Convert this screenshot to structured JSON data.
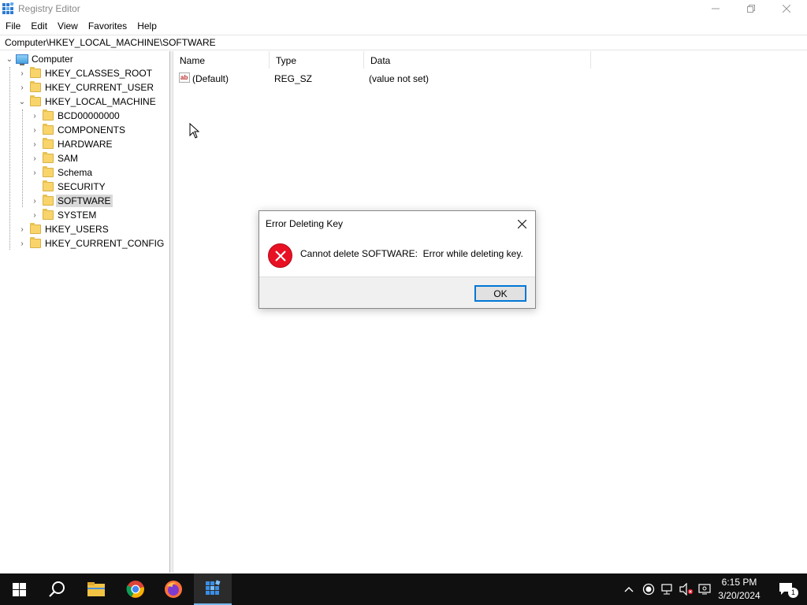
{
  "window": {
    "title": "Registry Editor"
  },
  "menu": [
    "File",
    "Edit",
    "View",
    "Favorites",
    "Help"
  ],
  "address": "Computer\\HKEY_LOCAL_MACHINE\\SOFTWARE",
  "tree": {
    "root": "Computer",
    "hives": [
      "HKEY_CLASSES_ROOT",
      "HKEY_CURRENT_USER",
      "HKEY_LOCAL_MACHINE",
      "HKEY_USERS",
      "HKEY_CURRENT_CONFIG"
    ],
    "hklm_children": [
      "BCD00000000",
      "COMPONENTS",
      "HARDWARE",
      "SAM",
      "Schema",
      "SECURITY",
      "SOFTWARE",
      "SYSTEM"
    ],
    "selected": "SOFTWARE"
  },
  "list": {
    "columns": [
      "Name",
      "Type",
      "Data"
    ],
    "rows": [
      {
        "name": "(Default)",
        "type": "REG_SZ",
        "data": "(value not set)"
      }
    ]
  },
  "dialog": {
    "title": "Error Deleting Key",
    "message": "Cannot delete SOFTWARE:  Error while deleting key.",
    "ok_label": "OK"
  },
  "taskbar": {
    "time": "6:15 PM",
    "date": "3/20/2024",
    "notification_count": "1",
    "icons": [
      "windows-start-icon",
      "search-icon",
      "file-explorer-icon",
      "chrome-icon",
      "firefox-icon",
      "registry-editor-icon"
    ]
  },
  "colors": {
    "error": "#e81123",
    "accent": "#0078d7",
    "taskbar": "#101010",
    "selection": "#d9d9d9"
  }
}
